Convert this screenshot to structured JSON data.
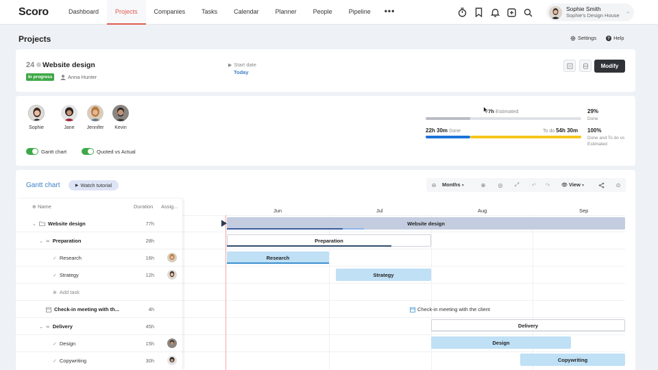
{
  "app": {
    "logo_text": "Scoro"
  },
  "nav": {
    "items": [
      "Dashboard",
      "Projects",
      "Companies",
      "Tasks",
      "Calendar",
      "Planner",
      "People",
      "Pipeline"
    ],
    "more": "•••",
    "icons": [
      "timer-icon",
      "bookmark-icon",
      "bell-icon",
      "add-icon",
      "search-icon"
    ]
  },
  "user": {
    "name": "Sophie Smith",
    "company": "Sophie's Design House"
  },
  "page": {
    "title": "Projects",
    "settings": "Settings",
    "help": "Help"
  },
  "project": {
    "number": "24",
    "name": "Website design",
    "status": "In progress",
    "owner": "Anna Hunter",
    "start_label": "Start date",
    "start_value": "Today",
    "modify_label": "Modify"
  },
  "team": {
    "members": [
      "Sophie",
      "Jane",
      "Jennifer",
      "Kevin"
    ],
    "toggles": [
      "Gantt chart",
      "Quoted vs Actual"
    ]
  },
  "stats": {
    "estimated_value": "77h",
    "estimated_label": "Estimated",
    "estimated_pct": "29%",
    "estimated_pct_label": "Done",
    "done_value": "22h 30m",
    "done_label": "Done",
    "todo_label": "To do",
    "todo_value": "54h 30m",
    "done_todo_pct": "100%",
    "done_todo_pct_label": "Done and To do vs Estimated",
    "colors": {
      "grey": "#b9bcc4",
      "blue": "#1a73d9",
      "yellow": "#f5c518"
    }
  },
  "gantt": {
    "title": "Gantt chart",
    "watch_label": "Watch tutorial",
    "zoom_label": "Months",
    "view_label": "View",
    "col_name": "Name",
    "col_duration": "Duration",
    "col_assignee": "Assig...",
    "months": [
      "Jun",
      "Jul",
      "Aug",
      "Sep"
    ],
    "rows": [
      {
        "name": "Website design",
        "duration": "77h",
        "level": 0,
        "bold": true
      },
      {
        "name": "Preparation",
        "duration": "28h",
        "level": 1,
        "bold": true
      },
      {
        "name": "Research",
        "duration": "16h",
        "level": 2,
        "bold": false
      },
      {
        "name": "Strategy",
        "duration": "12h",
        "level": 2,
        "bold": false
      },
      {
        "name": "Add task",
        "duration": "",
        "level": 2,
        "bold": false
      },
      {
        "name": "Check-in meeting with th...",
        "duration": "4h",
        "level": 1,
        "bold": true
      },
      {
        "name": "Delivery",
        "duration": "45h",
        "level": 1,
        "bold": true
      },
      {
        "name": "Design",
        "duration": "15h",
        "level": 2,
        "bold": false
      },
      {
        "name": "Copywriting",
        "duration": "30h",
        "level": 2,
        "bold": false
      }
    ],
    "bars": [
      "Website design",
      "Preparation",
      "Research",
      "Strategy",
      "Check-in meeting with the client",
      "Delivery",
      "Design",
      "Copywriting"
    ]
  }
}
